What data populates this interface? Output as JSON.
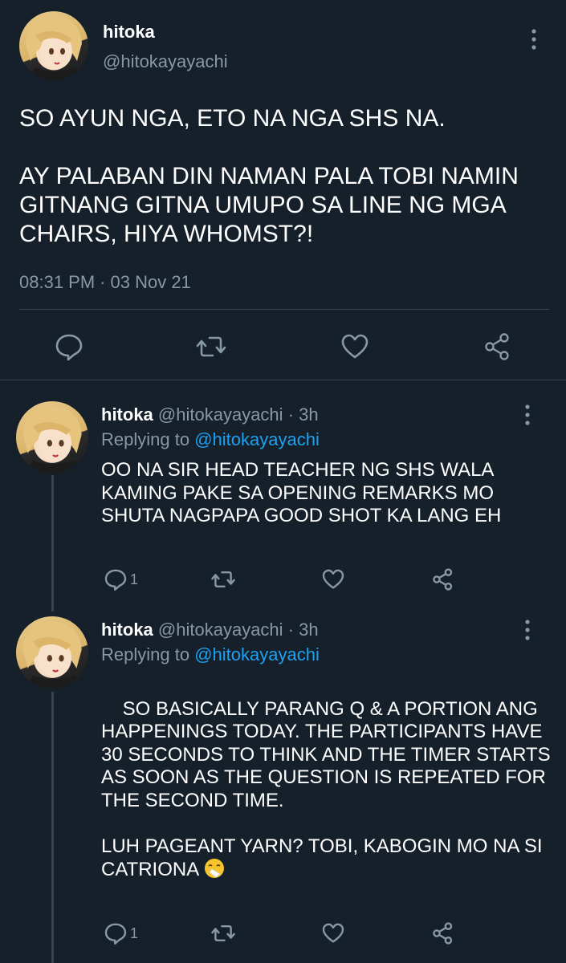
{
  "main_tweet": {
    "name": "hitoka",
    "handle": "@hitokayayachi",
    "text": "SO AYUN NGA, ETO NA NGA SHS NA.\n\nAY PALABAN DIN NAMAN PALA TOBI NAMIN GITNANG GITNA UMUPO SA LINE NG MGA CHAIRS, HIYA WHOMST?!",
    "time": "08:31 PM",
    "separator": "·",
    "date": "03 Nov 21"
  },
  "replies": [
    {
      "name": "hitoka",
      "handle": "@hitokayayachi",
      "separator": "·",
      "time": "3h",
      "replying_label": "Replying to",
      "replying_to": "@hitokayayachi",
      "text": "OO NA SIR HEAD TEACHER NG SHS WALA KAMING PAKE SA OPENING REMARKS MO SHUTA NAGPAPA GOOD SHOT KA LANG EH",
      "reply_count": "1"
    },
    {
      "name": "hitoka",
      "handle": "@hitokayayachi",
      "separator": "·",
      "time": "3h",
      "replying_label": "Replying to",
      "replying_to": "@hitokayayachi",
      "text": "SO BASICALLY PARANG Q & A PORTION ANG HAPPENINGS TODAY. THE PARTICIPANTS HAVE 30 SECONDS TO THINK AND THE TIMER STARTS AS SOON AS THE QUESTION IS REPEATED FOR THE SECOND TIME.\n\nLUH PAGEANT YARN? TOBI, KABOGIN MO NA SI CATRIONA",
      "emoji": "sneezing-face-emoji",
      "reply_count": "1"
    }
  ],
  "icons": {
    "reply": "speech-bubble-icon",
    "retweet": "retweet-icon",
    "like": "heart-icon",
    "share": "share-icon",
    "more": "vertical-dots-icon"
  },
  "colors": {
    "background": "#15202b",
    "text": "#ffffff",
    "secondary": "#8899a6",
    "mention": "#1da1f2",
    "divider": "#38444d"
  }
}
